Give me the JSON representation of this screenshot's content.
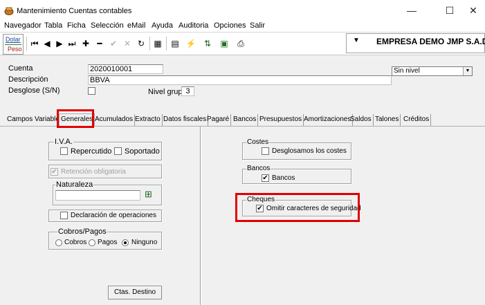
{
  "window": {
    "title": "Mantenimiento Cuentas contables",
    "minimize": "—",
    "maximize": "☐",
    "close": "✕"
  },
  "menu": [
    "Navegador",
    "Tabla",
    "Ficha",
    "Selección",
    "eMail",
    "Ayuda",
    "Auditoria",
    "Opciones",
    "Salir"
  ],
  "toolbar": {
    "currency_top": "Dolar",
    "currency_bottom": "Peso",
    "icons": {
      "first": "⏮",
      "prev": "◀",
      "next": "▶",
      "last": "⏭",
      "add": "✚",
      "remove": "━",
      "confirm": "✔",
      "cancel": "✕",
      "refresh": "↻",
      "grid": "▦",
      "card": "▤",
      "filter": "⚡",
      "tree": "⇅",
      "export": "▣",
      "print": "⎙"
    },
    "company": "EMPRESA DEMO JMP S.A.D",
    "company_arrow": "▼"
  },
  "form": {
    "cuenta_label": "Cuenta",
    "cuenta_value": "2020010001",
    "descripcion_label": "Descripción",
    "descripcion_value": "BBVA",
    "desglose_label": "Desglose (S/N)",
    "nivel_grupo_label": "Nivel grupo",
    "nivel_grupo_value": "3",
    "nivel_select": "Sin nivel",
    "select_arrow": "▼"
  },
  "tabs": [
    "Campos Variables",
    "Generales",
    "Acumulados",
    "Extracto",
    "Datos fiscales",
    "Pagaré",
    "Bancos",
    "Presupuestos",
    "Amortizaciones",
    "Saldos",
    "Talones",
    "Créditos"
  ],
  "left_panel": {
    "iva_title": "I.V.A.",
    "repercutido": "Repercutido",
    "soportado": "Soportado",
    "retencion": "Retención obligatoria",
    "retencion_check": "✔",
    "naturaleza_title": "Naturaleza",
    "naturaleza_icon": "⊞",
    "declaracion": "Declaración de operaciones",
    "cobros_title": "Cobros/Pagos",
    "cobros": "Cobros",
    "pagos": "Pagos",
    "ninguno": "Ninguno",
    "ctas_destino": "Ctas. Destino"
  },
  "right_panel": {
    "costes_title": "Costes",
    "desglosamos": "Desglosamos los costes",
    "bancos_title": "Bancos",
    "bancos": "Bancos",
    "bancos_check": "✔",
    "cheques_title": "Cheques",
    "omitir": "Omitir caracteres de seguridad",
    "omitir_check": "✔"
  }
}
